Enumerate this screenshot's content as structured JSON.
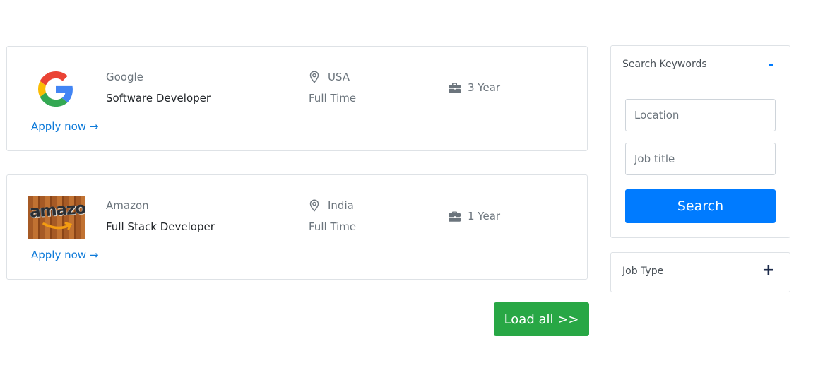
{
  "jobs": [
    {
      "company": "Google",
      "title": "Software Developer",
      "location": "USA",
      "type": "Full Time",
      "experience": "3 Year",
      "apply_label": "Apply now →",
      "logo_icon": "google-logo"
    },
    {
      "company": "Amazon",
      "title": "Full Stack Developer",
      "location": "India",
      "type": "Full Time",
      "experience": "1 Year",
      "apply_label": "Apply now →",
      "logo_icon": "amazon-logo",
      "logo_text": "amazon"
    }
  ],
  "load_all_label": "Load all >>",
  "sidebar": {
    "search": {
      "title": "Search Keywords",
      "toggle": "-",
      "location_placeholder": "Location",
      "jobtitle_placeholder": "Job title",
      "button_label": "Search"
    },
    "job_type": {
      "title": "Job Type",
      "toggle": "+"
    }
  },
  "colors": {
    "link": "#0d7ad9",
    "primary": "#007bff",
    "success": "#28a745",
    "muted": "#6c757d",
    "border": "#dee2e6"
  }
}
